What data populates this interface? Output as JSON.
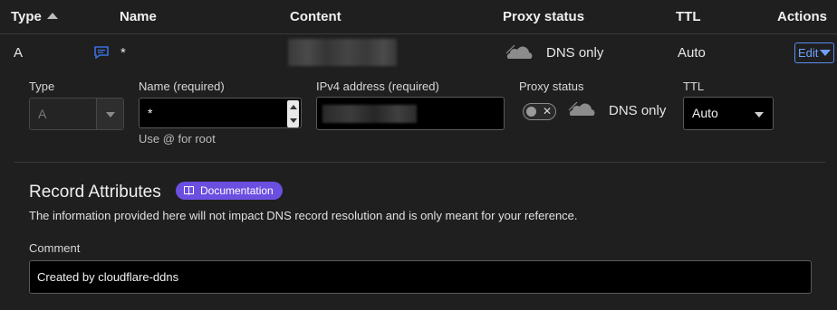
{
  "table": {
    "headers": {
      "type": "Type",
      "name": "Name",
      "content": "Content",
      "proxy_status": "Proxy status",
      "ttl": "TTL",
      "actions": "Actions"
    },
    "sort_icon": "sort-ascending-triangle",
    "row": {
      "type": "A",
      "comment_icon": "comment-icon",
      "name": "*",
      "content": "",
      "proxy_icon": "cloud-icon",
      "proxy_status": "DNS only",
      "ttl": "Auto",
      "edit_label": "Edit",
      "edit_icon": "caret-down-icon"
    }
  },
  "form": {
    "type": {
      "label": "Type",
      "value": "A",
      "disabled": true
    },
    "name": {
      "label": "Name (required)",
      "value": "*",
      "hint": "Use @ for root"
    },
    "ipv4": {
      "label": "IPv4 address (required)",
      "value": ""
    },
    "proxy": {
      "label": "Proxy status",
      "toggle_on": false,
      "status_text": "DNS only",
      "icon": "cloud-icon"
    },
    "ttl": {
      "label": "TTL",
      "value": "Auto"
    }
  },
  "record_attributes": {
    "title": "Record Attributes",
    "doc_badge": "Documentation",
    "doc_icon": "book-icon",
    "description": "The information provided here will not impact DNS record resolution and is only meant for your reference.",
    "comment_label": "Comment",
    "comment_value": "Created by cloudflare-ddns"
  },
  "colors": {
    "background": "#1f1f1f",
    "accent_link": "#6fa0ff",
    "badge": "#6b4fe0",
    "input_bg": "#000000",
    "comment_icon": "#3b6fe0"
  }
}
